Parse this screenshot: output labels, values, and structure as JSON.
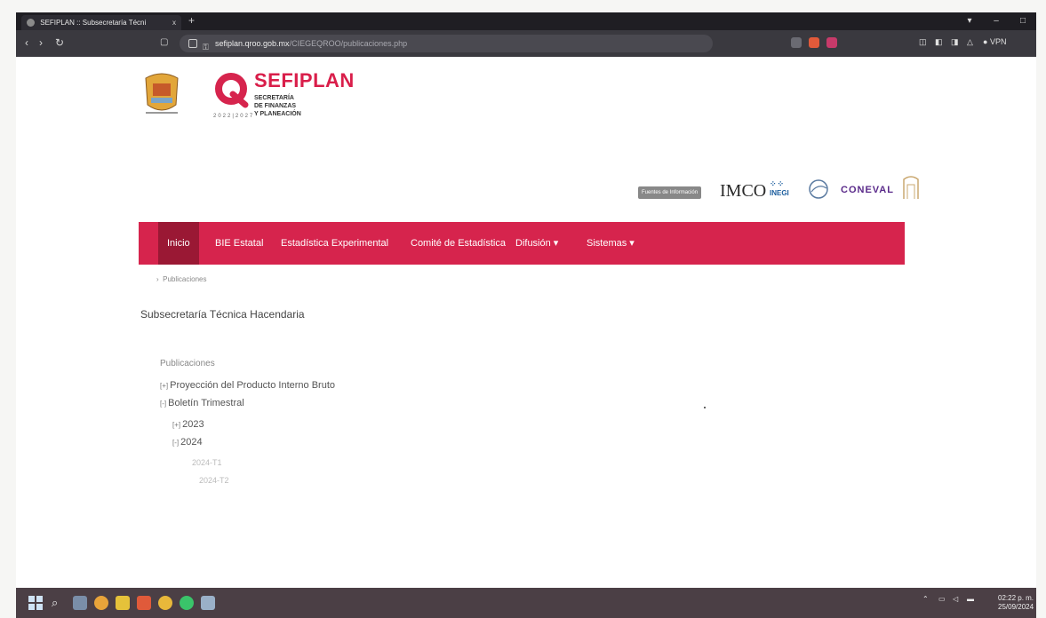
{
  "browser": {
    "tab_title": "SEFIPLAN :: Subsecretaría Técni",
    "tab_close": "x",
    "new_tab": "+",
    "url_domain": "sefiplan.qroo.gob.mx",
    "url_path": "/CIEGEQROO/publicaciones.php",
    "vpn_label": "VPN"
  },
  "header": {
    "brand_name": "SEFIPLAN",
    "brand_line1": "SECRETARÍA",
    "brand_line2": "DE FINANZAS",
    "brand_line3": "Y PLANEACIÓN",
    "year_strip": "2022|2027",
    "partners": {
      "fuentes_label": "Fuentes de Información",
      "imco": "IMCO",
      "inegi": "INEGI",
      "coneval": "CONEVAL"
    }
  },
  "nav": {
    "items": [
      {
        "label": "Inicio"
      },
      {
        "label": "BIE Estatal"
      },
      {
        "label": "Estadística Experimental"
      },
      {
        "label": "Comité de Estadística"
      },
      {
        "label": "Difusión ▾"
      },
      {
        "label": "Sistemas ▾"
      }
    ]
  },
  "breadcrumb": {
    "current": "Publicaciones"
  },
  "main": {
    "title": "Subsecretaría Técnica Hacendaria",
    "section_label": "Publicaciones",
    "tree": [
      {
        "marker": "[+]",
        "label": "Proyección del Producto Interno Bruto"
      },
      {
        "marker": "[-]",
        "label": "Boletín Trimestral"
      },
      {
        "marker": "[+]",
        "label": "2023"
      },
      {
        "marker": "[-]",
        "label": "2024"
      },
      {
        "label": "2024-T1"
      },
      {
        "label": "2024-T2"
      }
    ]
  },
  "taskbar": {
    "clock_time": "02:22 p. m.",
    "clock_date": "25/09/2024"
  },
  "colors": {
    "brand_red": "#d6244d",
    "active_nav": "#9a1834"
  }
}
